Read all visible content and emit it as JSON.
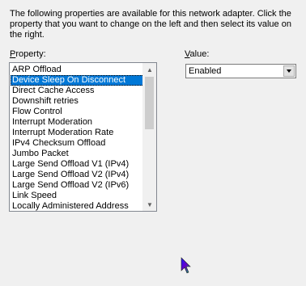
{
  "description": "The following properties are available for this network adapter. Click the property that you want to change on the left and then select its value on the right.",
  "property_label": {
    "accel": "P",
    "rest": "roperty:"
  },
  "value_label": {
    "accel": "V",
    "rest": "alue:"
  },
  "properties": [
    "ARP Offload",
    "Device Sleep On Disconnect",
    "Direct Cache Access",
    "Downshift retries",
    "Flow Control",
    "Interrupt Moderation",
    "Interrupt Moderation Rate",
    "IPv4 Checksum Offload",
    "Jumbo Packet",
    "Large Send Offload V1 (IPv4)",
    "Large Send Offload V2 (IPv4)",
    "Large Send Offload V2 (IPv6)",
    "Link Speed",
    "Locally Administered Address"
  ],
  "selected_property": "Device Sleep On Disconnect",
  "value": "Enabled",
  "colors": {
    "selection": "#0078d7",
    "background": "#f0f0f0"
  }
}
